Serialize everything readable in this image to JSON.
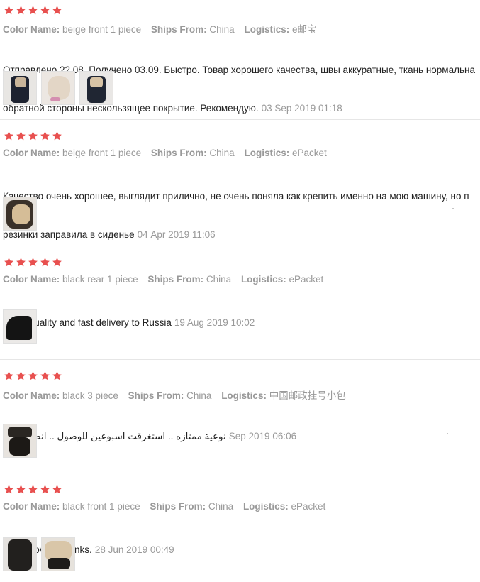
{
  "colors": {
    "star": "#e8504f",
    "meta": "#999999",
    "text": "#222222",
    "separator": "#e6e6e6"
  },
  "labels": {
    "color": "Color Name:",
    "ships": "Ships From:",
    "logistics": "Logistics:"
  },
  "reviews": [
    {
      "stars": 5,
      "color_value": "beige front 1 piece",
      "ships_value": "China",
      "logistics_value": "e邮宝",
      "text_line1": "Отправлено 22.08. Получено 03.09. Быстро. Товар хорошего качества, швы аккуратные, ткань нормальна",
      "text_line2": "обратной стороны нескользящее покрытие. Рекомендую.",
      "date": "03 Sep 2019 01:18",
      "photo_icons": [
        "photo-icon",
        "photo-icon",
        "photo-icon"
      ]
    },
    {
      "stars": 5,
      "color_value": "beige front 1 piece",
      "ships_value": "China",
      "logistics_value": "ePacket",
      "text_line1": "Качество очень хорошее, выглядит прилично, не очень поняла как крепить именно на мою машину, но п",
      "text_line2": "резинки заправила в сиденье",
      "date": "04 Apr 2019 11:06",
      "photo_icons": [
        "photo-icon"
      ]
    },
    {
      "stars": 5,
      "color_value": "black rear 1 piece",
      "ships_value": "China",
      "logistics_value": "ePacket",
      "text_line1": "Good quality and fast delivery to Russia",
      "date": "19 Aug 2019 10:02",
      "photo_icons": [
        "photo-icon"
      ]
    },
    {
      "stars": 5,
      "color_value": "black 3 piece",
      "ships_value": "China",
      "logistics_value": "中国邮政挂号小包",
      "text_line1": "03 نوعية ممتازه .. استغرقت اسبوعين للوصول .. انصح به",
      "date": "Sep 2019 06:06",
      "photo_icons": [
        "photo-icon"
      ]
    },
    {
      "stars": 5,
      "color_value": "black front 1 piece",
      "ships_value": "China",
      "logistics_value": "ePacket",
      "text_line1": "Great cover! Thanks.",
      "date": "28 Jun 2019 00:49",
      "photo_icons": [
        "photo-icon",
        "photo-icon"
      ]
    }
  ]
}
